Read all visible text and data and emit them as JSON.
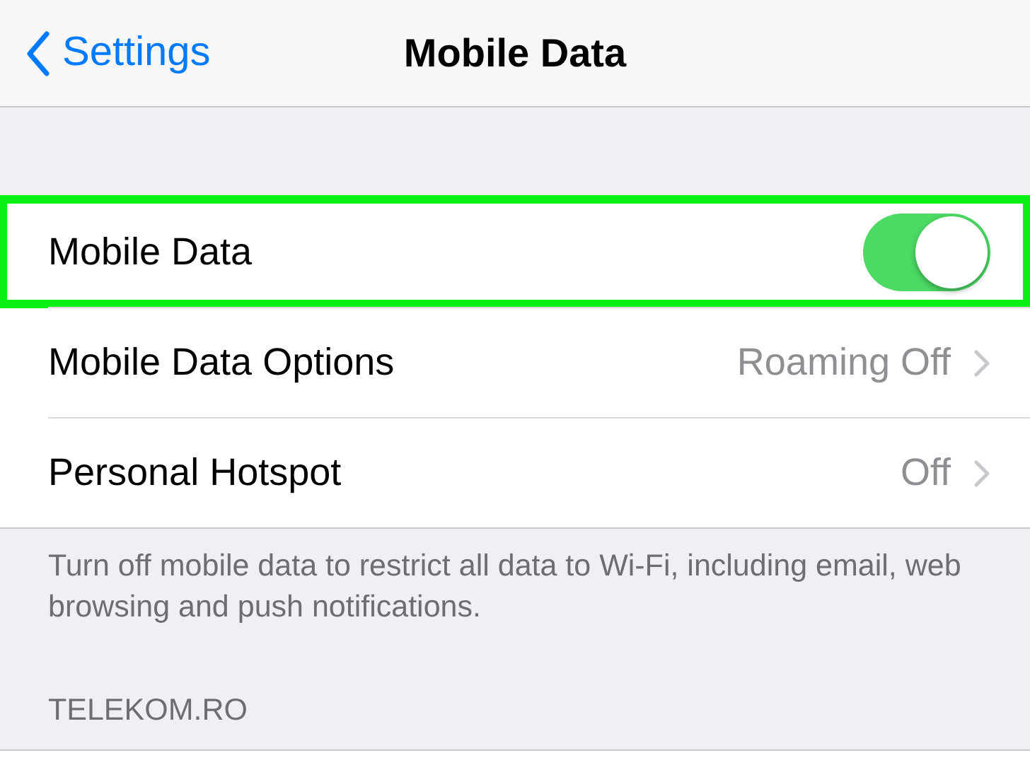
{
  "nav": {
    "back_label": "Settings",
    "title": "Mobile Data"
  },
  "rows": [
    {
      "kind": "switch",
      "label": "Mobile Data",
      "on": true,
      "highlighted": true
    },
    {
      "kind": "link",
      "label": "Mobile Data Options",
      "value": "Roaming Off",
      "highlighted": false
    },
    {
      "kind": "link",
      "label": "Personal Hotspot",
      "value": "Off",
      "highlighted": false
    }
  ],
  "footer": "Turn off mobile data to restrict all data to Wi-Fi, including email, web browsing and push notifications.",
  "section_header": "TELEKOM.RO"
}
